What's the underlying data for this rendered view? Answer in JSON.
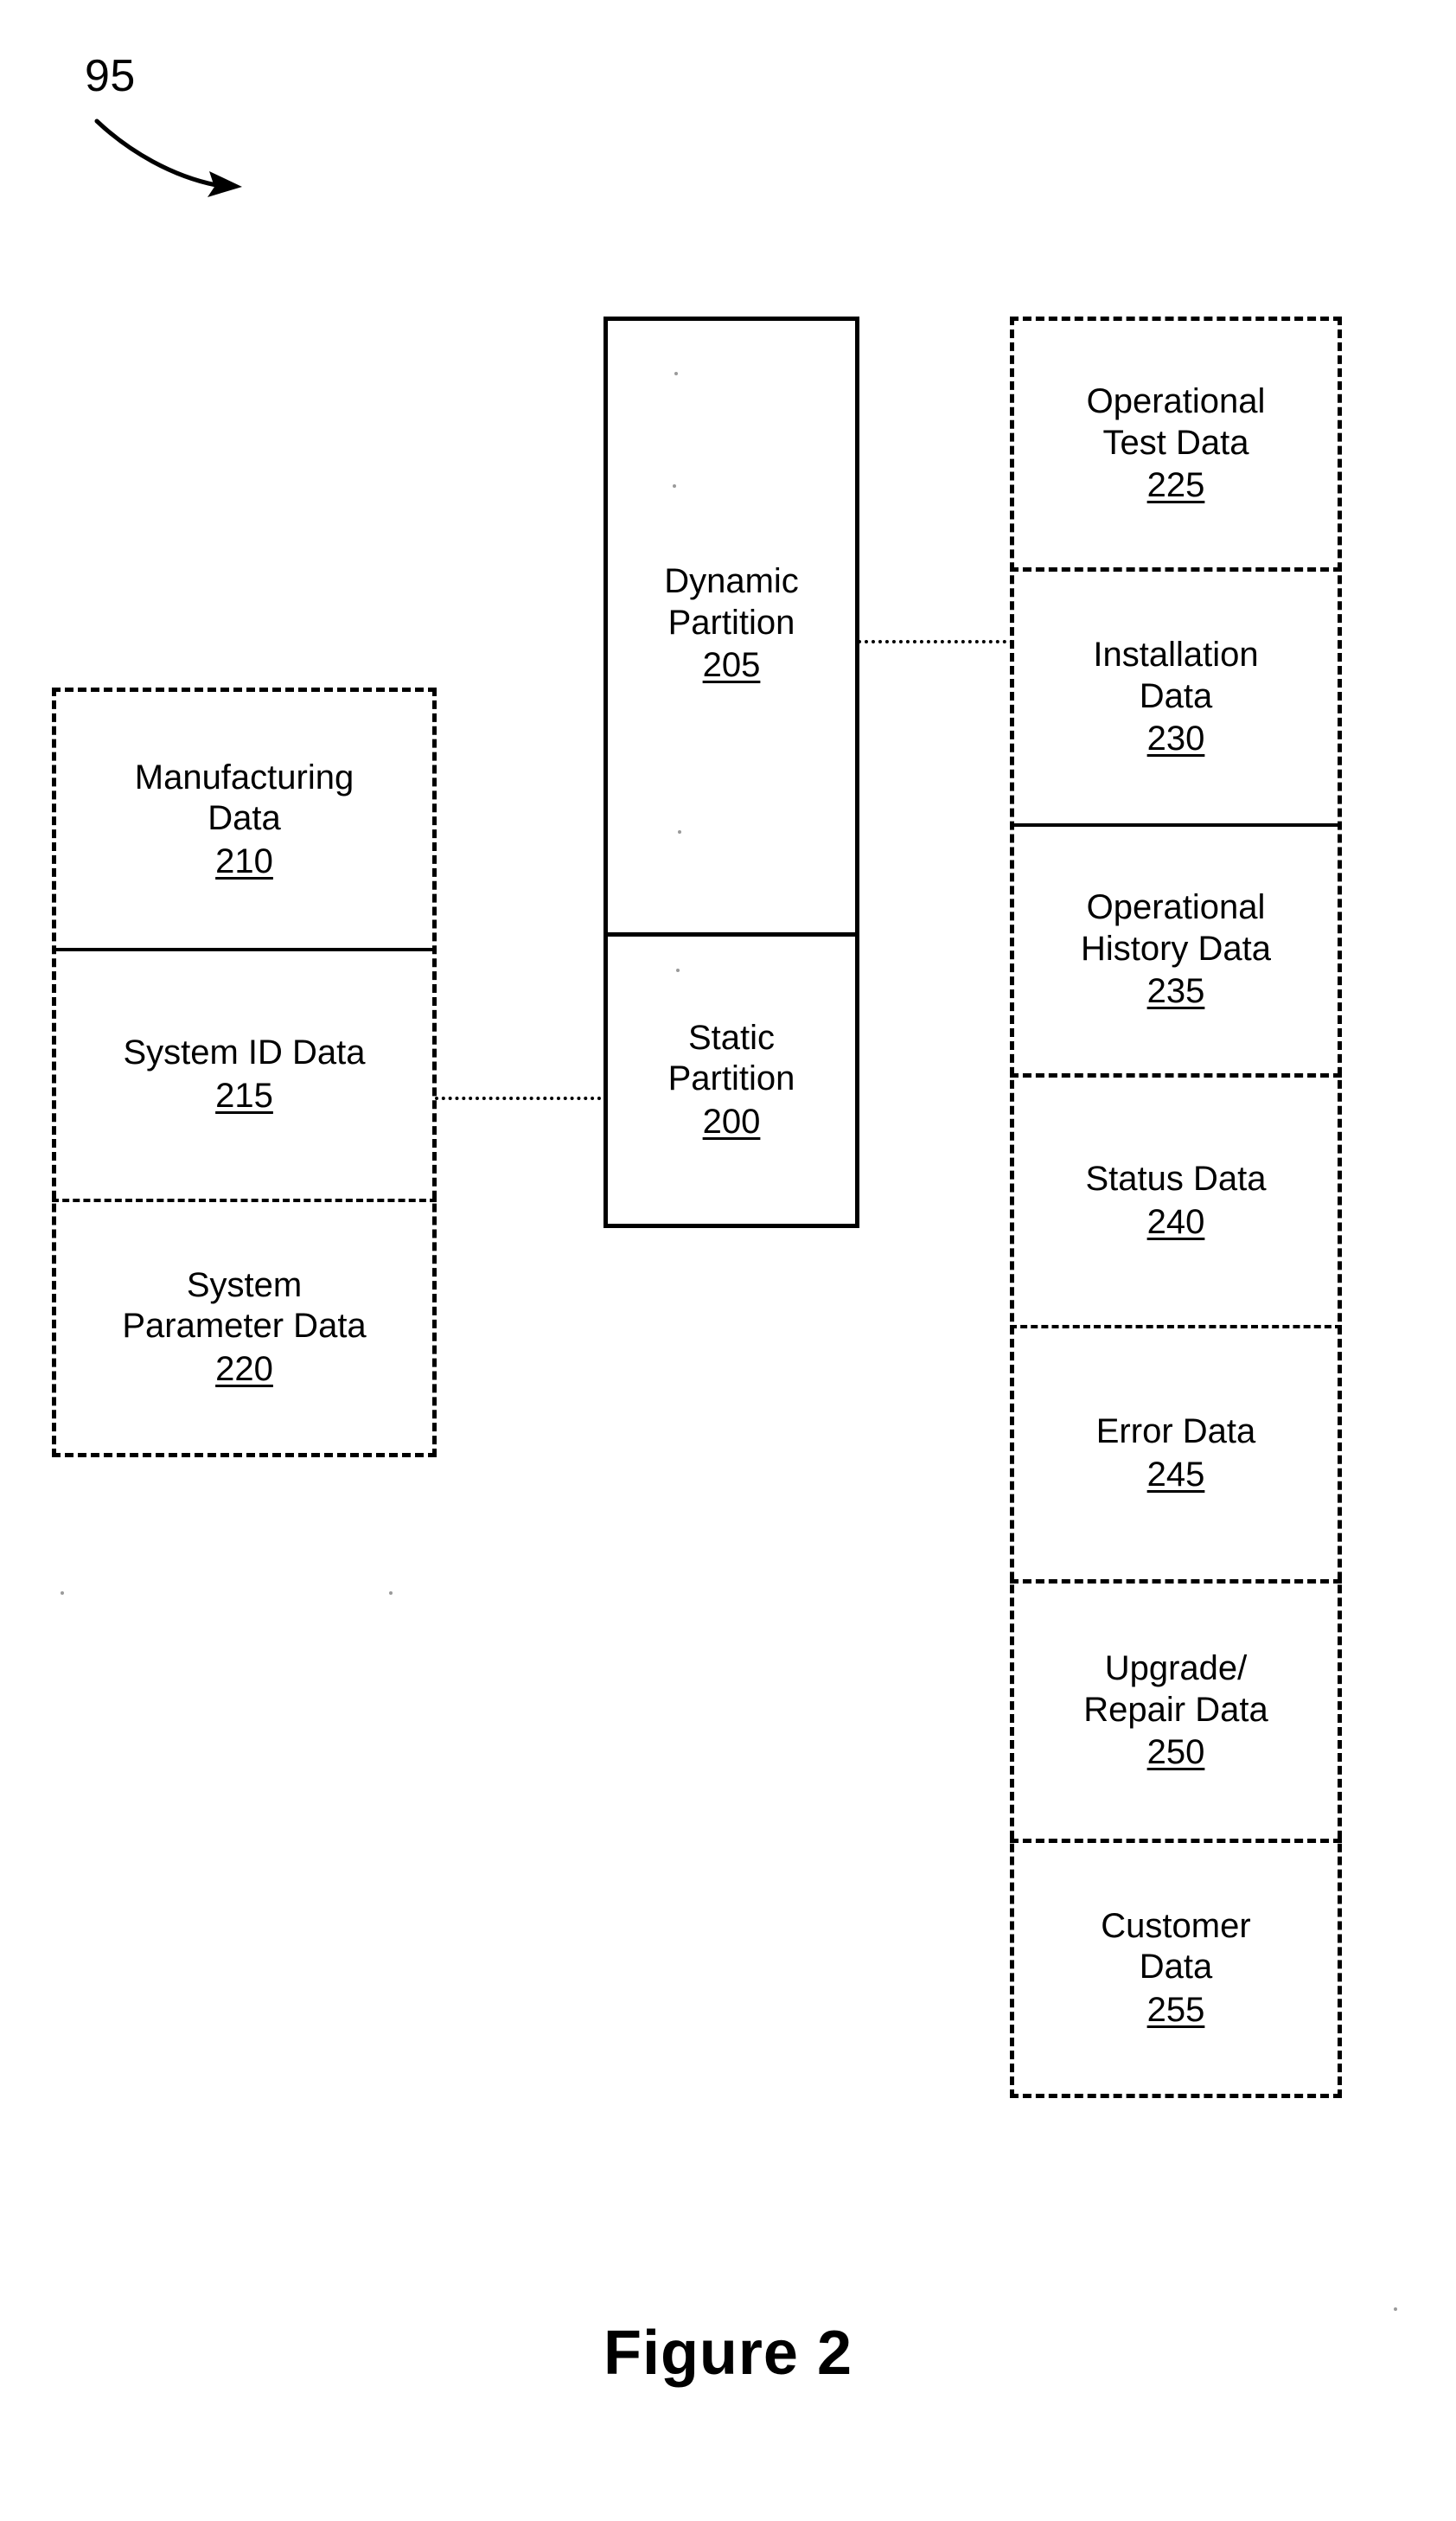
{
  "figure": {
    "reference_numeral": "95",
    "caption": "Figure 2"
  },
  "partition_stack": {
    "dynamic": {
      "label": "Dynamic\nPartition",
      "number": "205"
    },
    "static": {
      "label": "Static\nPartition",
      "number": "200"
    }
  },
  "static_partition_data": {
    "items": [
      {
        "label": "Manufacturing\nData",
        "number": "210"
      },
      {
        "label": "System ID Data",
        "number": "215"
      },
      {
        "label": "System\nParameter Data",
        "number": "220"
      }
    ]
  },
  "dynamic_partition_data": {
    "items": [
      {
        "label": "Operational\nTest Data",
        "number": "225"
      },
      {
        "label": "Installation\nData",
        "number": "230"
      },
      {
        "label": "Operational\nHistory Data",
        "number": "235"
      },
      {
        "label": "Status Data",
        "number": "240"
      },
      {
        "label": "Error Data",
        "number": "245"
      },
      {
        "label": "Upgrade/\nRepair Data",
        "number": "250"
      },
      {
        "label": "Customer\nData",
        "number": "255"
      }
    ]
  },
  "colors": {
    "ink": "#000000",
    "paper": "#ffffff"
  }
}
